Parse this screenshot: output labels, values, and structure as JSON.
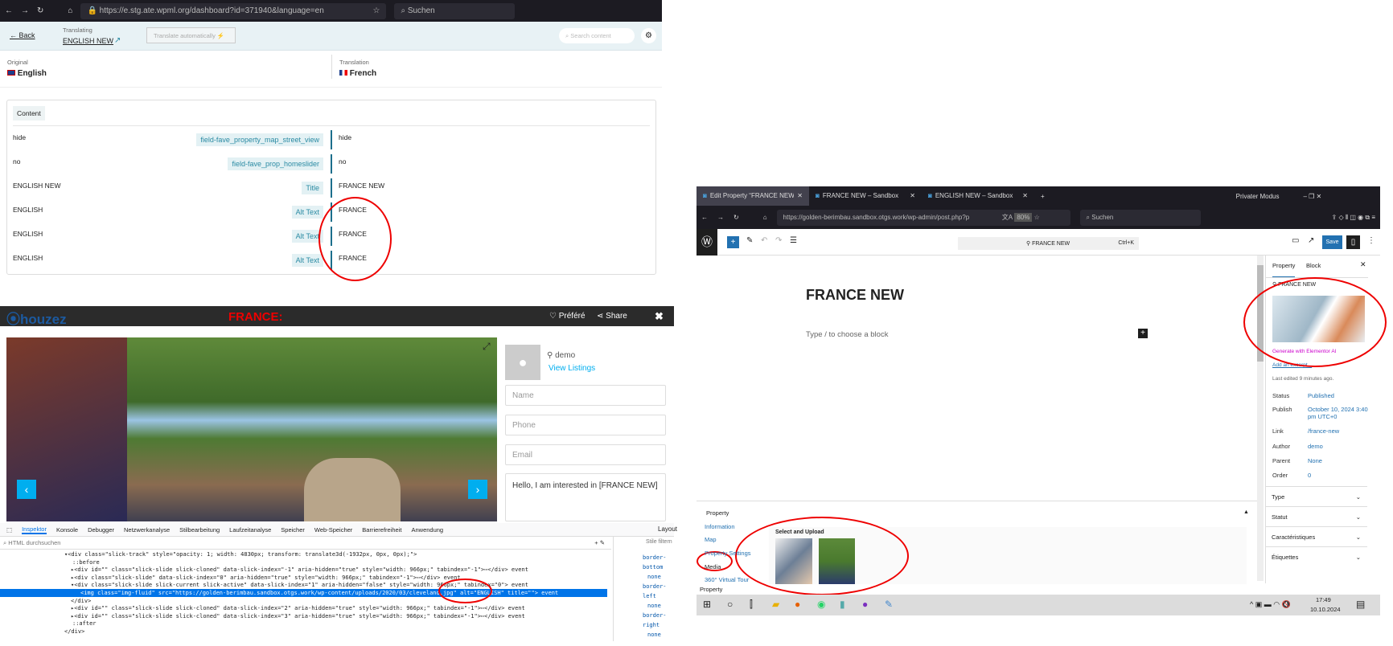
{
  "left_browser": {
    "url": "https://e.stg.ate.wpml.org/dashboard?id=371940&language=en",
    "search": "Suchen"
  },
  "wpml": {
    "back": "Back",
    "translating_label": "Translating",
    "doc_title": "ENGLISH NEW",
    "translate_auto": "Translate automatically",
    "search_placeholder": "Search content",
    "original_label": "Original",
    "original_lang": "English",
    "translation_label": "Translation",
    "translation_lang": "French",
    "content_tab": "Content",
    "rows": [
      {
        "src": "hide",
        "field": "field-fave_property_map_street_view",
        "tr": "hide"
      },
      {
        "src": "no",
        "field": "field-fave_prop_homeslider",
        "tr": "no"
      },
      {
        "src": "ENGLISH NEW",
        "field": "Title",
        "tr": "FRANCE NEW"
      },
      {
        "src": "ENGLISH",
        "field": "Alt Text",
        "tr": "FRANCE"
      },
      {
        "src": "ENGLISH",
        "field": "Alt Text",
        "tr": "FRANCE"
      },
      {
        "src": "ENGLISH",
        "field": "Alt Text",
        "tr": "FRANCE"
      }
    ]
  },
  "houzez": {
    "logo": "houzez",
    "annotation": "FRANCE:",
    "favorite": "Préféré",
    "share": "Share",
    "agent": "demo",
    "view_listings": "View Listings",
    "name_ph": "Name",
    "phone_ph": "Phone",
    "email_ph": "Email",
    "message": "Hello, I am interested in [FRANCE NEW]"
  },
  "devtools": {
    "tabs": [
      "Inspektor",
      "Konsole",
      "Debugger",
      "Netzwerkanalyse",
      "Stilbearbeitung",
      "Laufzeitanalyse",
      "Speicher",
      "Web-Speicher",
      "Barrierefreiheit",
      "Anwendung"
    ],
    "search_ph": "HTML durchsuchen",
    "styles_filter": "Stile filtern",
    "layout_tab": "Layout",
    "lines": [
      "▾<div class=\"slick-track\" style=\"opacity: 1; width: 4830px; transform: translate3d(-1932px, 0px, 0px);\">",
      "  ::before",
      "▸<div id=\"\" class=\"slick-slide slick-cloned\" data-slick-index=\"-1\" aria-hidden=\"true\" style=\"width: 966px;\" tabindex=\"-1\">⋯</div> event",
      "▸<div class=\"slick-slide\" data-slick-index=\"0\" aria-hidden=\"true\" style=\"width: 966px;\" tabindex=\"-1\">⋯</div> event",
      "▾<div class=\"slick-slide slick-current slick-active\" data-slick-index=\"1\" aria-hidden=\"false\" style=\"width: 966px;\" tabindex=\"0\"> event",
      "  <img class=\"img-fluid\" src=\"https://golden-berimbau.sandbox.otgs.work/wp-content/uploads/2020/03/cleveland.jpg\" alt=\"ENGLISH\" title=\"\"> event",
      "</div>",
      "▸<div id=\"\" class=\"slick-slide slick-cloned\" data-slick-index=\"2\" aria-hidden=\"true\" style=\"width: 966px;\" tabindex=\"-1\">⋯</div> event",
      "▸<div id=\"\" class=\"slick-slide slick-cloned\" data-slick-index=\"3\" aria-hidden=\"true\" style=\"width: 966px;\" tabindex=\"-1\">⋯</div> event",
      "  ::after",
      "</div>"
    ],
    "rules": [
      "border-bottom",
      "none",
      "border-left",
      "none",
      "border-right",
      "none"
    ]
  },
  "right_browser": {
    "tabs": [
      "Edit Property “FRANCE NEW” ‹",
      "FRANCE NEW – Sandbox",
      "ENGLISH NEW – Sandbox"
    ],
    "private": "Privater Modus",
    "url": "https://golden-berimbau.sandbox.otgs.work/wp-admin/post.php?p",
    "zoom": "80%",
    "search": "Suchen"
  },
  "wp": {
    "command": "FRANCE NEW",
    "shortcut": "Ctrl+K",
    "save": "Save",
    "post_title": "FRANCE NEW",
    "block_ph": "Type / to choose a block",
    "sidebar_tabs": [
      "Property",
      "Block"
    ],
    "featured_title": "FRANCE NEW",
    "ai": "Generate with Elementor AI",
    "excerpt": "Add an excerpt...",
    "last_edited": "Last edited 9 minutes ago.",
    "meta": [
      {
        "k": "Status",
        "v": "Published"
      },
      {
        "k": "Publish",
        "v": "October 10, 2024 3:40 pm UTC+0"
      },
      {
        "k": "Link",
        "v": "/france-new"
      },
      {
        "k": "Author",
        "v": "demo"
      },
      {
        "k": "Parent",
        "v": "None"
      },
      {
        "k": "Order",
        "v": "0"
      }
    ],
    "panels": [
      "Type",
      "Statut",
      "Caractéristiques",
      "Étiquettes"
    ],
    "metabox_title": "Property",
    "metabox_nav": [
      "Information",
      "Map",
      "Property Settings",
      "Media",
      "360° Virtual Tour"
    ],
    "upload_label": "Select and Upload",
    "footer": "Property"
  },
  "taskbar": {
    "time": "17:49",
    "date": "10.10.2024"
  }
}
